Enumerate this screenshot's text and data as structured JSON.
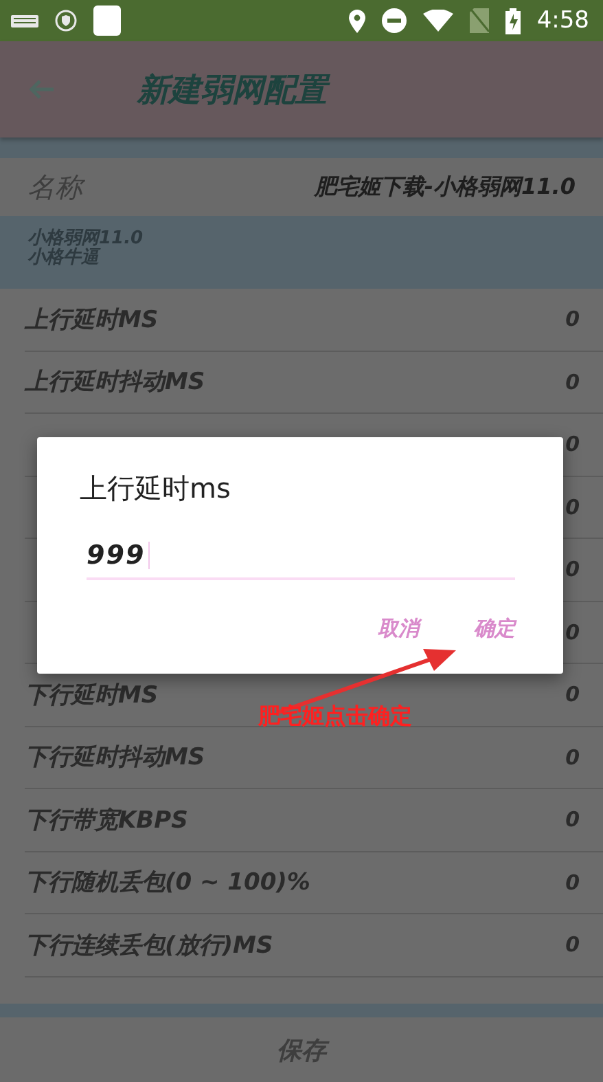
{
  "status_bar": {
    "time": "4:58"
  },
  "app_bar": {
    "title": "新建弱网配置"
  },
  "name_row": {
    "label": "名称",
    "value": "肥宅姬下载-小格弱网11.0"
  },
  "profile": {
    "lines": [
      "小格弱网11.0",
      "小格牛逼"
    ]
  },
  "settings": [
    {
      "label": "上行延时MS",
      "value": "0"
    },
    {
      "label": "上行延时抖动MS",
      "value": "0"
    },
    {
      "value": "0"
    },
    {
      "value": "0"
    },
    {
      "value": "0"
    },
    {
      "value": "0"
    },
    {
      "label": "下行延时MS",
      "value": "0"
    },
    {
      "label": "下行延时抖动MS",
      "value": "0"
    },
    {
      "label": "下行带宽KBPS",
      "value": "0"
    },
    {
      "label": "下行随机丢包(0 ~ 100)%",
      "value": "0"
    },
    {
      "label": "下行连续丢包(放行)MS",
      "value": "0"
    }
  ],
  "save_button": {
    "label": "保存"
  },
  "dialog": {
    "title": "上行延时ms",
    "value": "999",
    "buttons": [
      "取消",
      "确定"
    ]
  },
  "annotation": {
    "text": "肥宅姬点击确定"
  }
}
